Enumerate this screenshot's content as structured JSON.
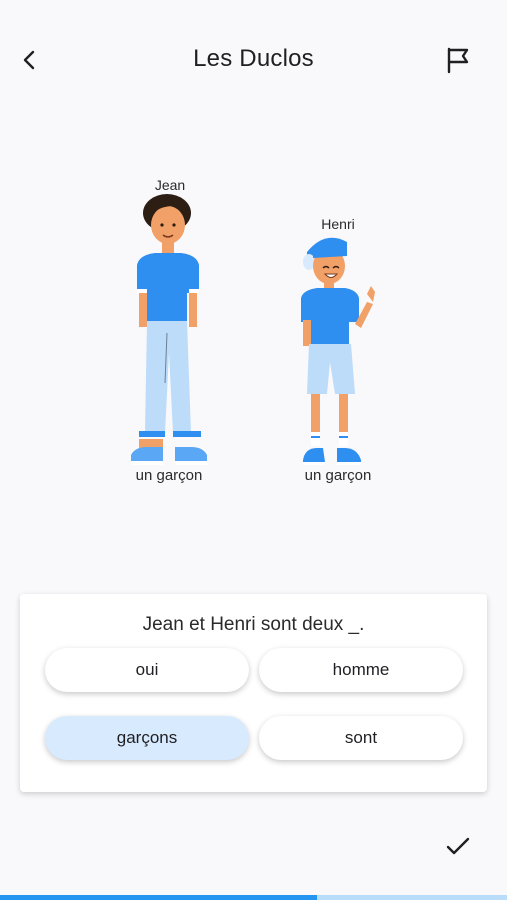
{
  "header": {
    "title": "Les Duclos",
    "back_icon": "chevron-left-icon",
    "flag_icon": "flag-icon"
  },
  "scene": {
    "characters": [
      {
        "name": "Jean",
        "caption": "un garçon"
      },
      {
        "name": "Henri",
        "caption": "un garçon"
      }
    ]
  },
  "quiz": {
    "question": "Jean et Henri sont deux _.",
    "options": [
      {
        "label": "oui",
        "selected": false
      },
      {
        "label": "homme",
        "selected": false
      },
      {
        "label": "garçons",
        "selected": true
      },
      {
        "label": "sont",
        "selected": false
      }
    ]
  },
  "footer": {
    "check_icon": "checkmark-icon"
  },
  "progress": {
    "fraction": 0.625
  },
  "colors": {
    "accent": "#2496f2",
    "selected_option": "#d8eafd",
    "track": "#b9dcfb"
  }
}
